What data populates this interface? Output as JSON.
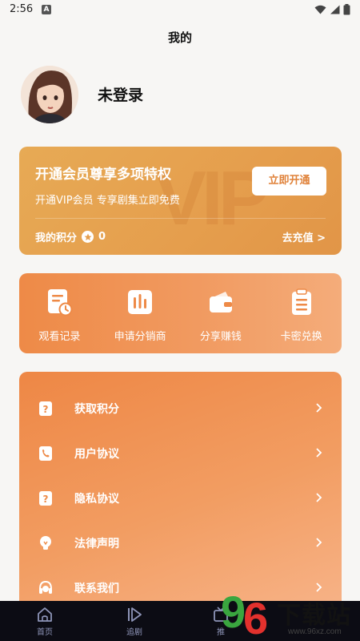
{
  "status_bar": {
    "time": "2:56",
    "a_icon": "A"
  },
  "page_title": "我的",
  "user": {
    "name": "未登录",
    "avatar": "avatar-girl-illustration"
  },
  "vip": {
    "title": "开通会员尊享多项特权",
    "subtitle": "开通VIP会员 专享剧集立即免费",
    "button": "立即开通",
    "watermark": "VIP",
    "points_label": "我的积分",
    "points_value": "0",
    "recharge": "去充值 >"
  },
  "features": [
    {
      "label": "观看记录",
      "icon": "history-icon"
    },
    {
      "label": "申请分销商",
      "icon": "chart-bars-icon"
    },
    {
      "label": "分享赚钱",
      "icon": "wallet-icon"
    },
    {
      "label": "卡密兑换",
      "icon": "clipboard-icon"
    }
  ],
  "menu": [
    {
      "label": "获取积分",
      "icon": "question-icon"
    },
    {
      "label": "用户协议",
      "icon": "phone-book-icon"
    },
    {
      "label": "隐私协议",
      "icon": "question-icon"
    },
    {
      "label": "法律声明",
      "icon": "lightbulb-icon"
    },
    {
      "label": "联系我们",
      "icon": "headset-icon"
    }
  ],
  "tabbar": [
    {
      "label": "首页",
      "icon": "home-icon"
    },
    {
      "label": "追剧",
      "icon": "play-icon"
    },
    {
      "label": "推",
      "icon": "tv-icon"
    }
  ],
  "watermark": {
    "digit1": "9",
    "digit2": "6",
    "text": "下载站",
    "url": "www.96xz.com"
  },
  "colors": {
    "vip_gold": "#e59e4d",
    "accent_orange": "#ee8a47",
    "tabbar_bg": "#0c0c14"
  }
}
